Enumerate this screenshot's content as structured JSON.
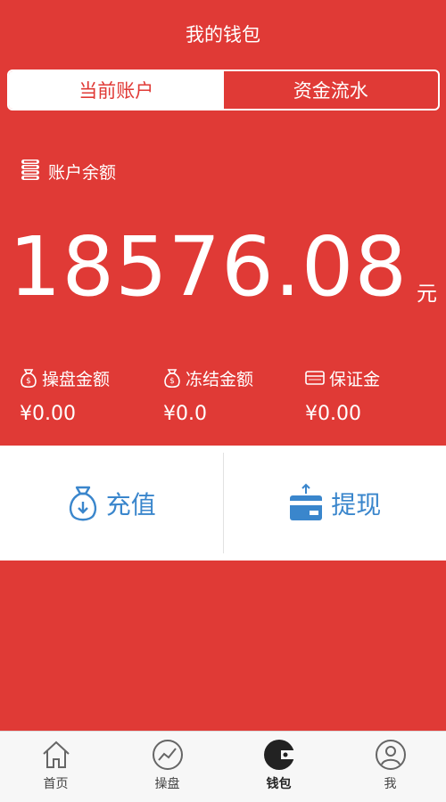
{
  "header": {
    "title": "我的钱包"
  },
  "segments": [
    {
      "label": "当前账户",
      "active": true
    },
    {
      "label": "资金流水",
      "active": false
    }
  ],
  "balance": {
    "label": "账户余额",
    "amount": "18576.08",
    "unit": "元"
  },
  "stats": [
    {
      "label": "操盘金额",
      "value": "¥0.00",
      "icon": "money-bag-icon"
    },
    {
      "label": "冻结金额",
      "value": "¥0.0",
      "icon": "money-bag-icon"
    },
    {
      "label": "保证金",
      "value": "¥0.00",
      "icon": "card-icon"
    }
  ],
  "actions": {
    "recharge": {
      "label": "充值",
      "icon": "money-bag-download-icon"
    },
    "withdraw": {
      "label": "提现",
      "icon": "card-upload-icon"
    }
  },
  "tabbar": [
    {
      "label": "首页",
      "icon": "home-icon",
      "active": false
    },
    {
      "label": "操盘",
      "icon": "chart-line-icon",
      "active": false
    },
    {
      "label": "钱包",
      "icon": "wallet-icon",
      "active": true
    },
    {
      "label": "我",
      "icon": "user-icon",
      "active": false
    }
  ],
  "colors": {
    "primary": "#e03a36",
    "accent": "#3a86cc",
    "white": "#ffffff"
  }
}
